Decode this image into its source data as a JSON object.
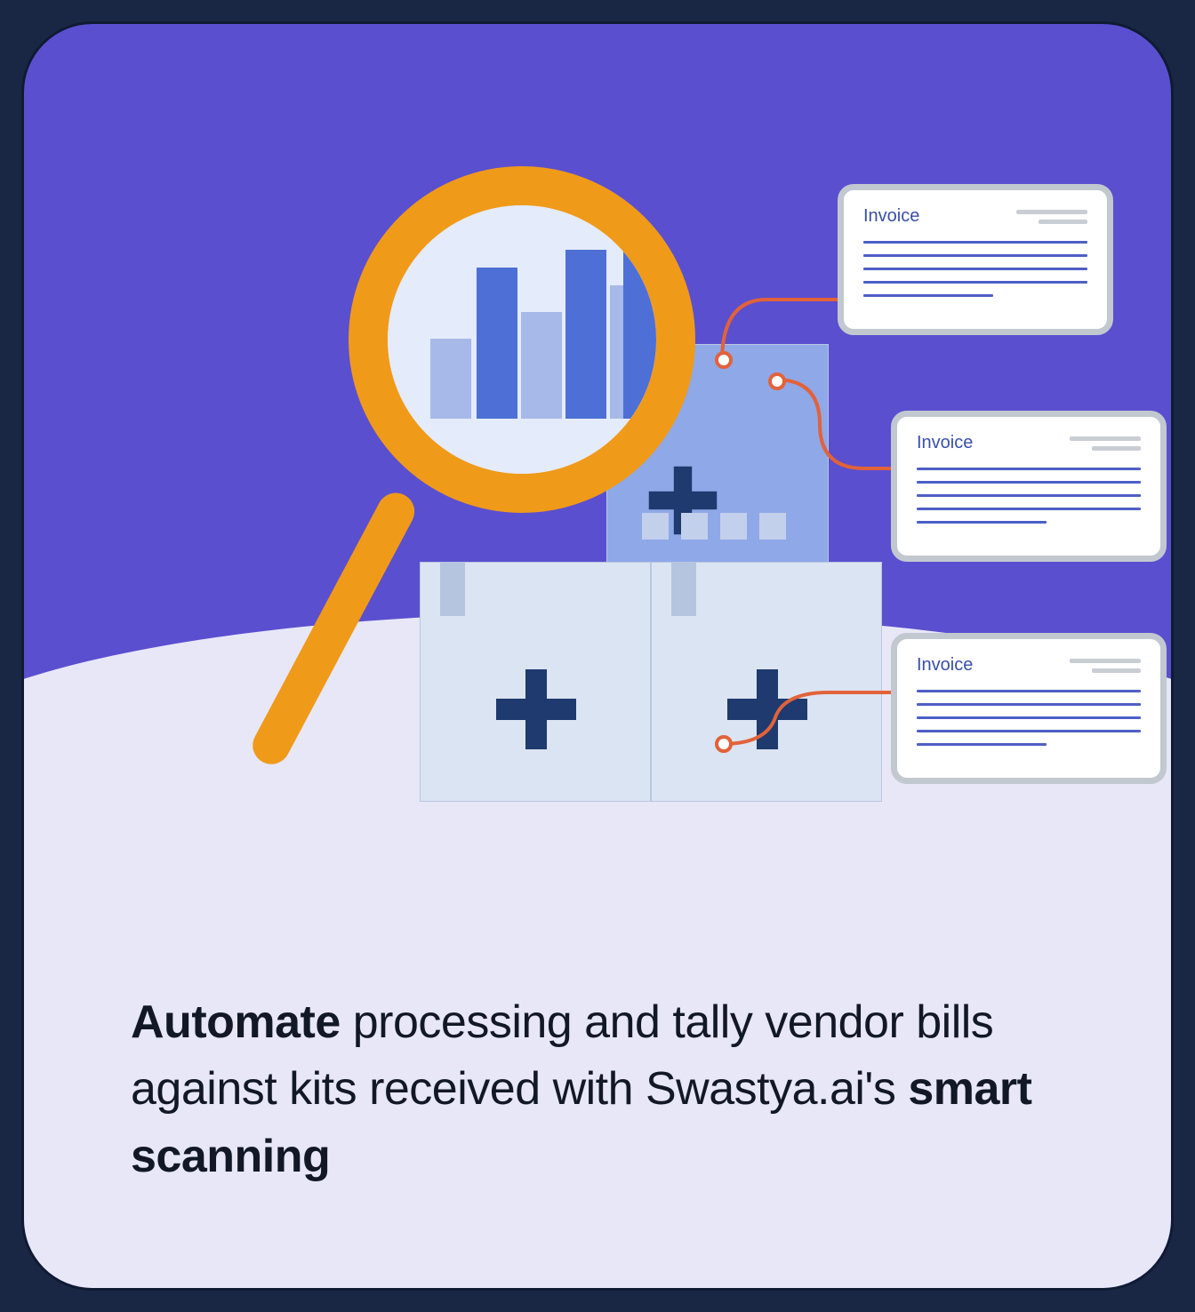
{
  "invoice_label": "Invoice",
  "caption": {
    "bold1": "Automate",
    "mid": " processing and tally vendor bills against kits received with Swastya.ai's ",
    "bold2": "smart scanning"
  }
}
